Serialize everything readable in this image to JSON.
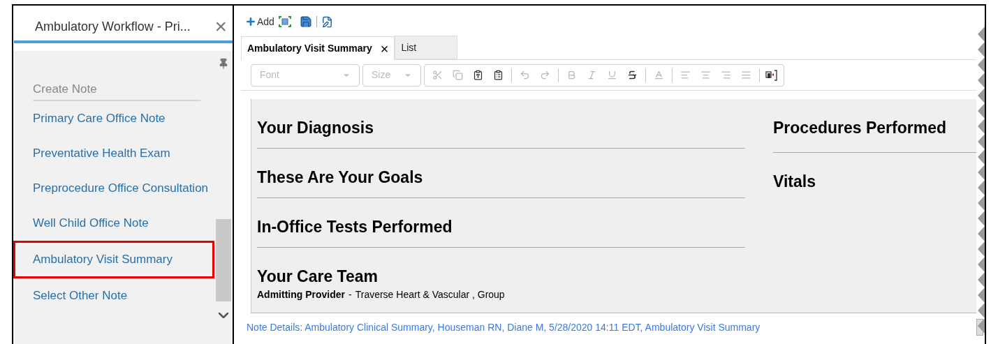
{
  "sidebar": {
    "title": "Ambulatory Workflow - Pri...",
    "close": "×",
    "section": "Create Note",
    "items": [
      {
        "label": "Primary Care Office Note",
        "highlighted": false
      },
      {
        "label": "Preventative Health Exam",
        "highlighted": false
      },
      {
        "label": "Preprocedure Office Consultation",
        "highlighted": false
      },
      {
        "label": "Well Child Office Note",
        "highlighted": false
      },
      {
        "label": "Ambulatory Visit Summary",
        "highlighted": true
      },
      {
        "label": "Select Other Note",
        "highlighted": false
      }
    ]
  },
  "toolbar": {
    "add": "Add"
  },
  "tabs": [
    {
      "label": "Ambulatory Visit Summary",
      "selected": true,
      "close": "×"
    },
    {
      "label": "List",
      "selected": false
    }
  ],
  "editor_toolbar": {
    "font": {
      "placeholder": "Font"
    },
    "size": {
      "placeholder": "Size"
    },
    "tools": [
      {
        "kind": "cut",
        "disabled": true
      },
      {
        "kind": "copy",
        "disabled": true
      },
      {
        "kind": "paste-text",
        "disabled": false
      },
      {
        "kind": "paste",
        "disabled": false
      },
      {
        "kind": "sep"
      },
      {
        "kind": "undo",
        "disabled": true
      },
      {
        "kind": "redo",
        "disabled": true
      },
      {
        "kind": "sep"
      },
      {
        "kind": "bold",
        "disabled": true
      },
      {
        "kind": "italic",
        "disabled": true
      },
      {
        "kind": "underline",
        "disabled": true
      },
      {
        "kind": "strike",
        "disabled": false
      },
      {
        "kind": "sep"
      },
      {
        "kind": "font-color",
        "disabled": true
      },
      {
        "kind": "sep"
      },
      {
        "kind": "align-left",
        "disabled": true
      },
      {
        "kind": "align-center",
        "disabled": true
      },
      {
        "kind": "align-right",
        "disabled": true
      },
      {
        "kind": "justify",
        "disabled": true
      },
      {
        "kind": "sep"
      },
      {
        "kind": "insert",
        "disabled": false
      }
    ]
  },
  "document": {
    "left_sections": [
      "Your Diagnosis",
      "These Are Your Goals",
      "In-Office Tests Performed",
      "Your Care Team"
    ],
    "care_team": {
      "label": "Admitting Provider",
      "separator": "-",
      "value": "Traverse Heart & Vascular , Group"
    },
    "right_sections": [
      "Procedures Performed",
      "Vitals"
    ]
  },
  "note_details": "Note Details: Ambulatory Clinical Summary, Houseman RN, Diane M, 5/28/2020 14:11 EDT, Ambulatory Visit Summary"
}
